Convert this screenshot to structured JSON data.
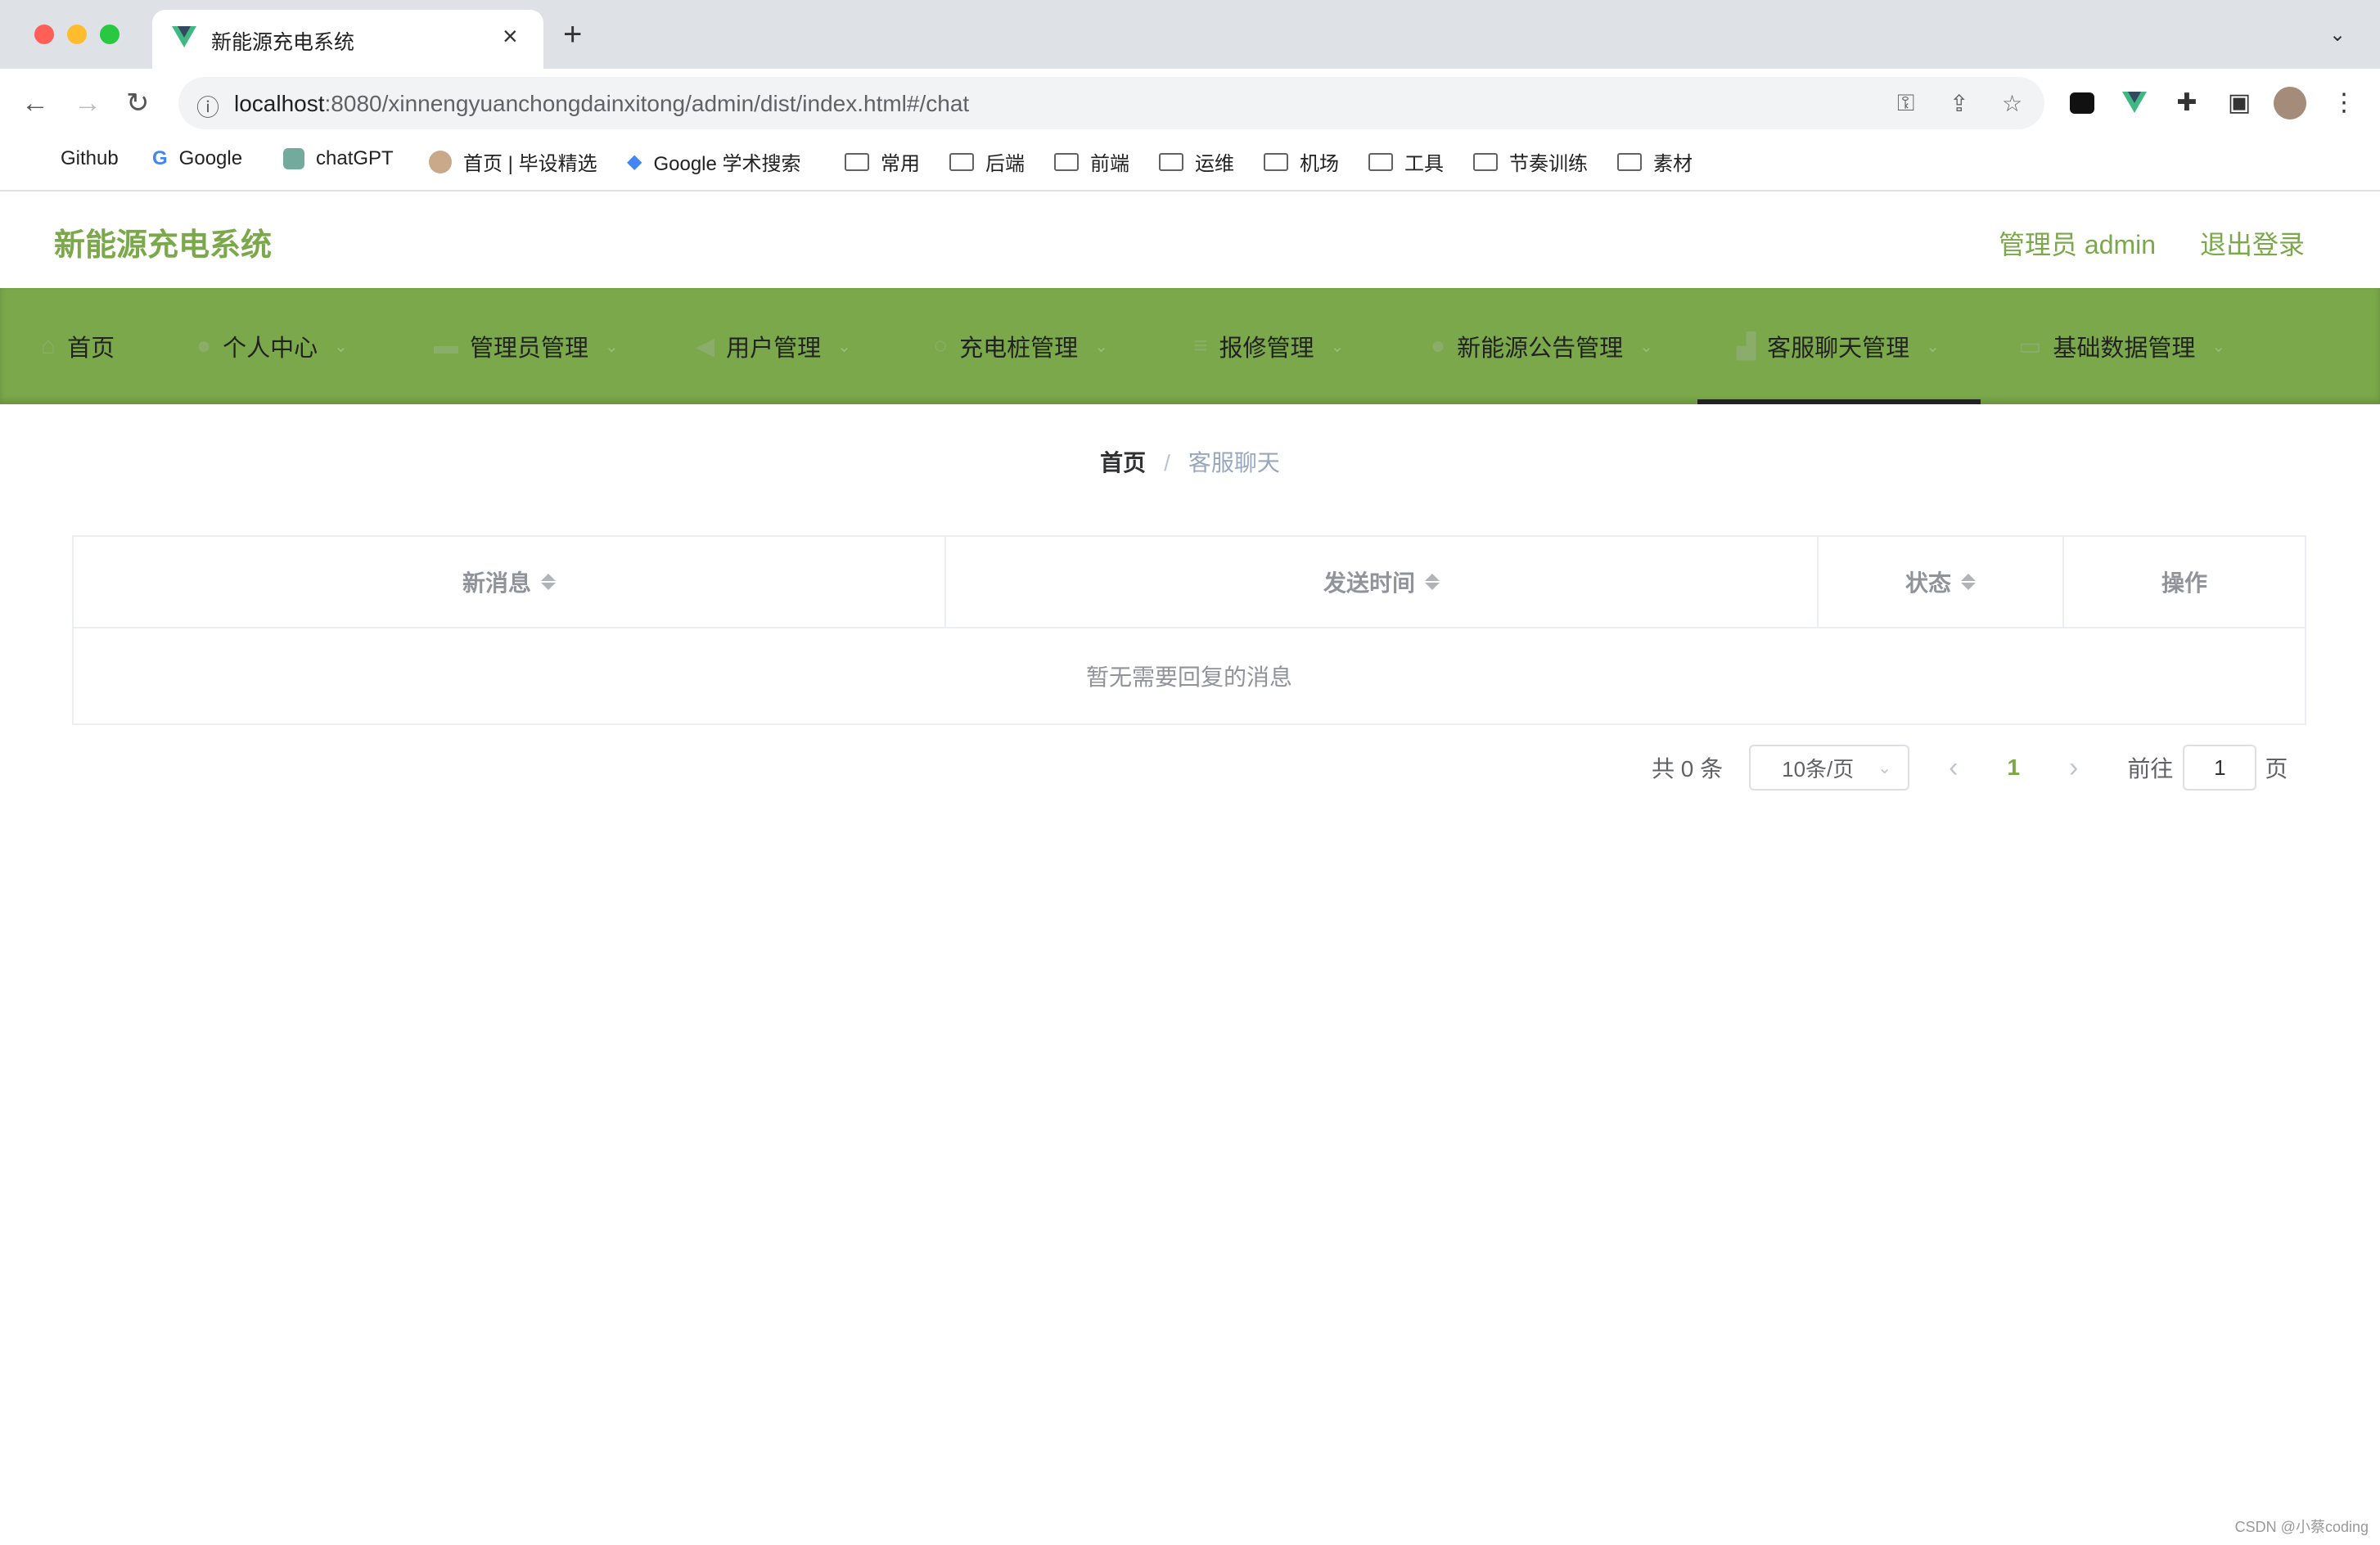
{
  "browser": {
    "tab_title": "新能源充电系统",
    "url_host": "localhost",
    "url_rest": ":8080/xinnengyuanchongdainxitong/admin/dist/index.html#/chat",
    "bookmarks": [
      "Github",
      "Google",
      "chatGPT",
      "首页 | 毕设精选",
      "Google 学术搜索",
      "常用",
      "后端",
      "前端",
      "运维",
      "机场",
      "工具",
      "节奏训练",
      "素材"
    ]
  },
  "header": {
    "title": "新能源充电系统",
    "user": "管理员 admin",
    "logout": "退出登录"
  },
  "nav": {
    "items": [
      "首页",
      "个人中心",
      "管理员管理",
      "用户管理",
      "充电桩管理",
      "报修管理",
      "新能源公告管理",
      "客服聊天管理",
      "基础数据管理"
    ],
    "active": "客服聊天管理"
  },
  "breadcrumb": {
    "home": "首页",
    "separator": "/",
    "current": "客服聊天"
  },
  "table": {
    "columns": [
      "新消息",
      "发送时间",
      "状态",
      "操作"
    ],
    "empty_text": "暂无需要回复的消息"
  },
  "pagination": {
    "total": "共 0 条",
    "page_size": "10条/页",
    "prev": "‹",
    "current_page": "1",
    "next": "›",
    "goto_label": "前往",
    "goto_value": "1",
    "page_suffix": "页"
  },
  "watermark": "CSDN @小蔡coding",
  "colors": {
    "brand_green": "#7aa84a",
    "active_page": "#7aa84a"
  }
}
